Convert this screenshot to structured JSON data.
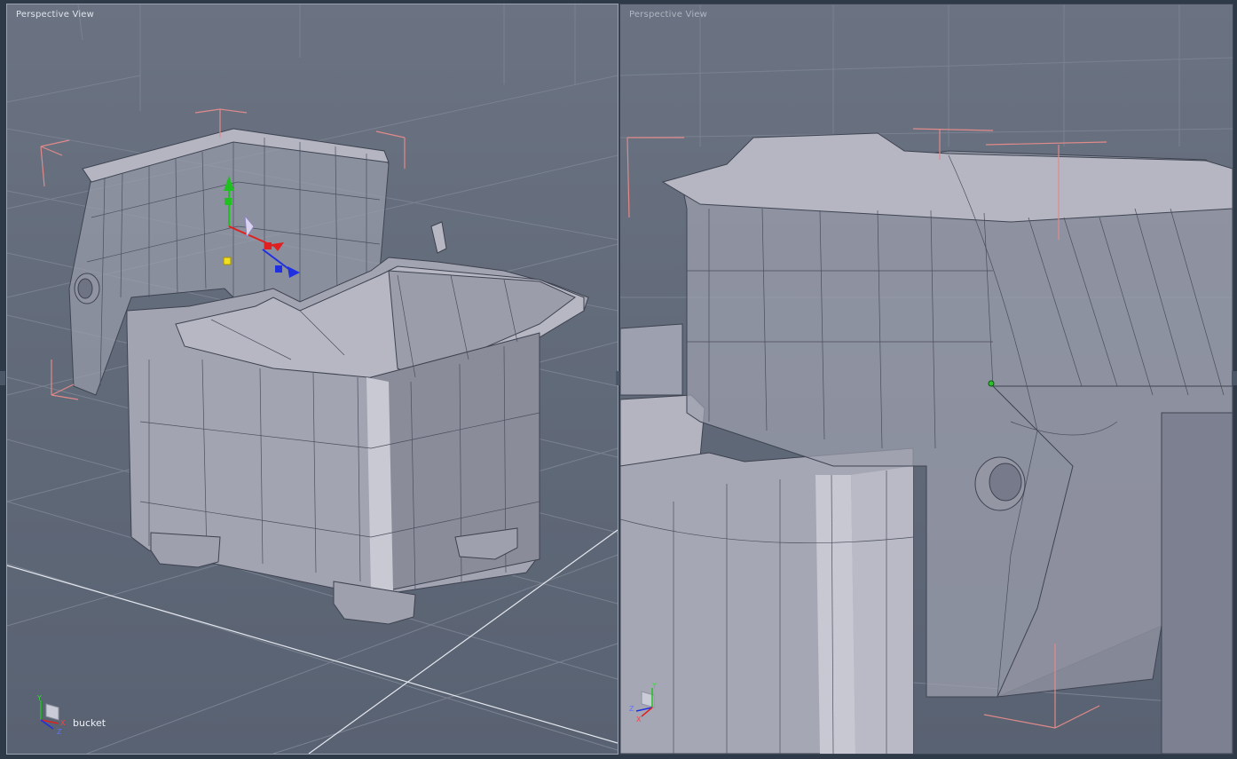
{
  "viewports": {
    "left": {
      "title": "Perspective View",
      "object_label": "bucket"
    },
    "right": {
      "title": "Perspective View"
    }
  },
  "axis_icon": {
    "x": "X",
    "y": "Y",
    "z": "Z"
  },
  "colors": {
    "background": "#2f3a48",
    "viewport_bg": "#646c7b",
    "grid_line": "#7a8291",
    "model_fill": "#a7a8b5",
    "wire": "#4a4e5c",
    "bbox_corner": "#e08a8a",
    "gizmo_x": "#e02020",
    "gizmo_y": "#20c020",
    "gizmo_z": "#2030e0"
  },
  "icons": [
    "axis-orientation-icon",
    "move-gizmo-icon",
    "pivot-point-icon"
  ]
}
